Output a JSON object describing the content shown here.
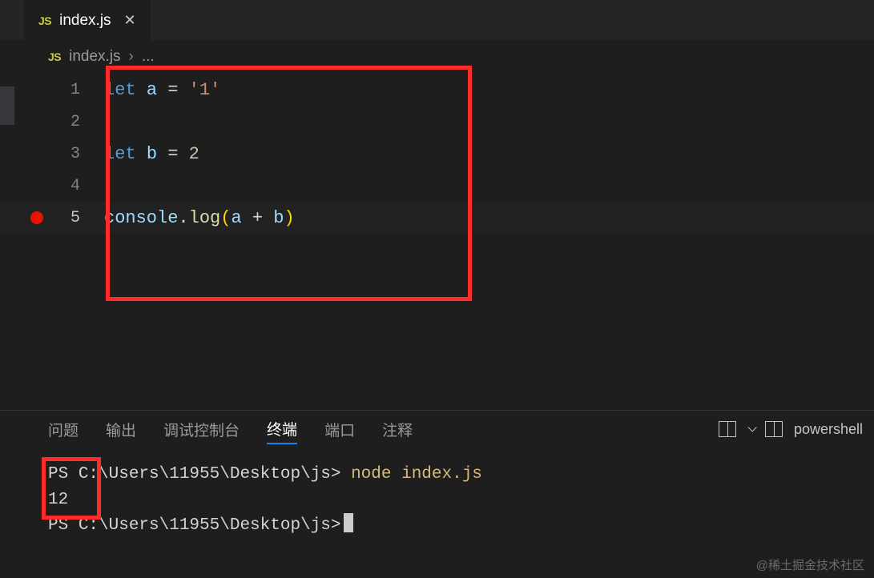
{
  "tab": {
    "icon_label": "JS",
    "filename": "index.js"
  },
  "breadcrumb": {
    "icon_label": "JS",
    "filename": "index.js",
    "sep": "›",
    "rest": "..."
  },
  "code": {
    "lines": [
      {
        "n": "1",
        "tokens": [
          [
            "kw",
            "let"
          ],
          [
            "sp",
            " "
          ],
          [
            "var",
            "a"
          ],
          [
            "sp",
            " "
          ],
          [
            "op",
            "="
          ],
          [
            "sp",
            " "
          ],
          [
            "str",
            "'1'"
          ]
        ]
      },
      {
        "n": "2",
        "tokens": []
      },
      {
        "n": "3",
        "tokens": [
          [
            "kw",
            "let"
          ],
          [
            "sp",
            " "
          ],
          [
            "var",
            "b"
          ],
          [
            "sp",
            " "
          ],
          [
            "op",
            "="
          ],
          [
            "sp",
            " "
          ],
          [
            "num",
            "2"
          ]
        ]
      },
      {
        "n": "4",
        "tokens": []
      },
      {
        "n": "5",
        "breakpoint": true,
        "current": true,
        "tokens": [
          [
            "obj",
            "console"
          ],
          [
            "punc",
            "."
          ],
          [
            "fn",
            "log"
          ],
          [
            "paren",
            "("
          ],
          [
            "var",
            "a"
          ],
          [
            "sp",
            " "
          ],
          [
            "op",
            "+"
          ],
          [
            "sp",
            " "
          ],
          [
            "var",
            "b"
          ],
          [
            "paren",
            ")"
          ]
        ]
      }
    ]
  },
  "panel": {
    "tabs": {
      "problems": "问题",
      "output": "输出",
      "debug": "调试控制台",
      "terminal": "终端",
      "ports": "端口",
      "comments": "注释",
      "active": "terminal"
    },
    "shell_label": "powershell"
  },
  "terminal": {
    "prompt1_prefix": "PS ",
    "prompt1_path": "C:\\Users\\11955\\Desktop\\js>",
    "cmd": "node index.js",
    "output": "12",
    "prompt2_prefix": "PS ",
    "prompt2_path": "C:\\Users\\11955\\Desktop\\js>"
  },
  "watermark": "@稀土掘金技术社区"
}
